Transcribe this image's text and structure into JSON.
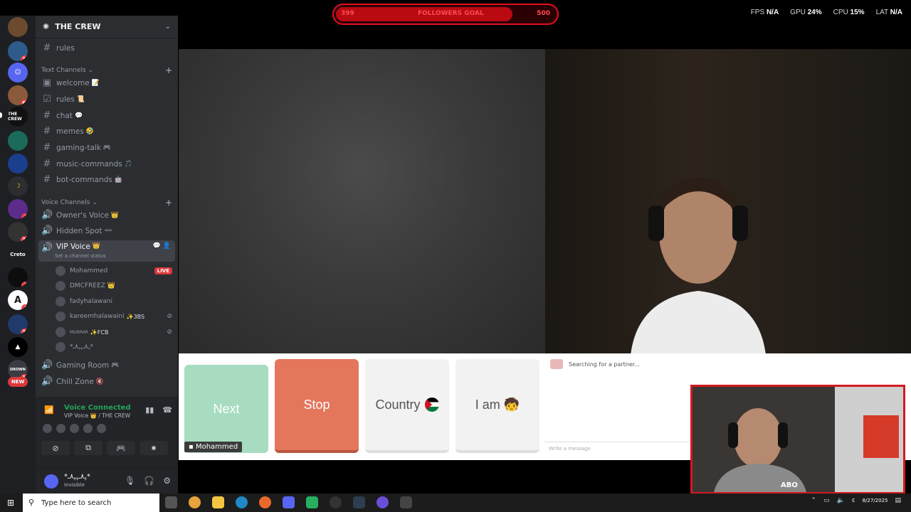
{
  "server": {
    "name": "THE CREW"
  },
  "channels": {
    "top": {
      "name": "rules"
    },
    "text_category": "Text Channels",
    "text": [
      {
        "name": "welcome",
        "emoji": "📝"
      },
      {
        "name": "rules",
        "emoji": "📜"
      },
      {
        "name": "chat",
        "emoji": "💬"
      },
      {
        "name": "memes",
        "emoji": "🤣"
      },
      {
        "name": "gaming-talk",
        "emoji": "🎮"
      },
      {
        "name": "music-commands",
        "emoji": "🎵"
      },
      {
        "name": "bot-commands",
        "emoji": "🤖"
      }
    ],
    "voice_category": "Voice Channels",
    "voice": [
      {
        "name": "Owner's Voice",
        "emoji": "👑"
      },
      {
        "name": "Hidden Spot",
        "emoji": "➖"
      },
      {
        "name": "VIP Voice",
        "emoji": "👑",
        "status": "Set a channel status"
      },
      {
        "name": "Gaming Room",
        "emoji": "🎮"
      },
      {
        "name": "Chill Zone",
        "emoji": "🔇"
      }
    ],
    "vip_members": [
      {
        "name": "Mohammed",
        "live": "LIVE"
      },
      {
        "name": "DMCFREEZ",
        "badge": "👑"
      },
      {
        "name": "fadyhalawani"
      },
      {
        "name": "kareemhalawaini",
        "badge": "✨3BS"
      },
      {
        "name": "MURRAR",
        "badge": "✨FCB"
      },
      {
        "name": "*ﮩ٨ـﮩﮩ٨ـ*"
      }
    ]
  },
  "voice_panel": {
    "title": "Voice Connected",
    "subtitle": "VIP Voice 👑 / THE CREW"
  },
  "user": {
    "name": "*ﮩ٨ـﮩﮩ٨ـ*",
    "status": "Invisible"
  },
  "rail": {
    "badges": [
      "19",
      "69",
      "1",
      "30",
      "1",
      "5",
      "39",
      "10",
      "NEW"
    ],
    "labels": {
      "crew": "THE CREW",
      "creto": "Creto",
      "drown": "DROWN"
    }
  },
  "overlay": {
    "goal_left": "399",
    "goal_label": "FOLLOWERS GOAL",
    "goal_right": "500",
    "fps_label": "FPS",
    "fps_value": "N/A",
    "gpu_label": "GPU",
    "gpu_value": "24%",
    "cpu_label": "CPU",
    "cpu_value": "15%",
    "lat_label": "LAT",
    "lat_value": "N/A"
  },
  "controls": {
    "next": "Next",
    "stop": "Stop",
    "country": "Country",
    "iam": "I am",
    "iam_emoji": "🧒",
    "user_tag": "Mohammed",
    "chat_status": "Searching for a partner...",
    "message_placeholder": "Write a message"
  },
  "webcam": {
    "brand": "ABO"
  },
  "taskbar": {
    "search_placeholder": "Type here to search",
    "date": "8/27/2025",
    "lang": "ε"
  }
}
